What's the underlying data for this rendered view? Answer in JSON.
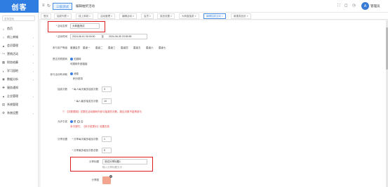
{
  "app": {
    "logo": "创客"
  },
  "topbar": {
    "nav_active": "三级测试",
    "nav_plain": "编辑抽奖活动",
    "user_initial": "A",
    "user_name": "管理员"
  },
  "sidebar": {
    "search_placeholder": "菜单搜索",
    "items": [
      {
        "icon": "⌂",
        "label": "首页",
        "arrow": ""
      },
      {
        "icon": "♀",
        "label": "线上商城",
        "arrow": "›"
      },
      {
        "icon": "▲",
        "label": "会员管理",
        "arrow": "›"
      },
      {
        "icon": "〜",
        "label": "营销活动",
        "arrow": "›"
      },
      {
        "icon": "▦",
        "label": "财务结算",
        "arrow": "›"
      },
      {
        "icon": "◐",
        "label": "学习园地",
        "arrow": "›"
      },
      {
        "icon": "◉",
        "label": "数据分析",
        "arrow": "›"
      },
      {
        "icon": "✚",
        "label": "服务通知",
        "arrow": ""
      },
      {
        "icon": "●",
        "label": "企业管理",
        "arrow": "›"
      },
      {
        "icon": "▤",
        "label": "系统管理",
        "arrow": ""
      },
      {
        "icon": "⚙",
        "label": "系统设置",
        "arrow": "›"
      }
    ]
  },
  "tabs": [
    {
      "label": "首页",
      "active": false
    },
    {
      "label": "抽奖列表 ×",
      "active": false
    },
    {
      "label": "线上商城 ×",
      "active": false
    },
    {
      "label": "活动管理 ×",
      "active": false
    },
    {
      "label": "编辑活动 ×",
      "active": false
    },
    {
      "label": "会员 ×",
      "active": false
    },
    {
      "label": "奖品设置 ×",
      "active": false
    },
    {
      "label": "大转盘抽奖 ×",
      "active": false
    },
    {
      "label": "编辑抽奖活动 ×",
      "active": true
    },
    {
      "label": "新建奖品页 ×",
      "active": false
    }
  ],
  "form": {
    "activity_name_label": "* 活动名称",
    "activity_name_value": "大转盘测试",
    "time_label": "* 活动时间",
    "time_start": "2024-06-01 00:00:00",
    "time_sep": "至",
    "time_end": "2024-06-30 23:59:59",
    "participants_label": "参与用户等级",
    "levels": [
      "普通会员",
      "星级一",
      "星级二",
      "星级三",
      "星级四",
      "星级五",
      "星级六",
      "星级七"
    ],
    "jump_label": "是否关联跳转",
    "jump_opt1": "无跳转",
    "jump_opt2": "可跳转外部链接",
    "share_label": "参与活动有消耗",
    "share_opt1": "消费",
    "share_opt2": "积分抵扣",
    "draw_times_label": "抽奖次数",
    "draw_daily_label": "* 每人每天最多抽奖次数",
    "draw_daily_value": "3",
    "draw_total_label": "* 每人最多抽奖总次数",
    "draw_total_value": "10",
    "warning": "① 【次数限制】仅限在活动期间内参与抽奖的次数，超出次数不能再参与",
    "first_prize_label": "允许中奖",
    "first_opt_yes": "是",
    "first_opt_no": "否",
    "first_warning": "未中奖时，【未中奖提示】设置无效",
    "share_setting_label": "分享设置",
    "share_daily_label": "* 分享每次最多增加次数",
    "share_daily_value": "1",
    "share_max_label": "* 分享最多增加次数总数",
    "share_max_value": "5",
    "share_title_label": "分享标题",
    "share_title_value": "测试分享标题1",
    "share_title_hint": "输入分享标题文字",
    "share_img_label": "分享图"
  },
  "colors": {
    "accent": "#4a90e2",
    "logo_bg": "#2f7de1",
    "highlight_box": "#e02020"
  }
}
